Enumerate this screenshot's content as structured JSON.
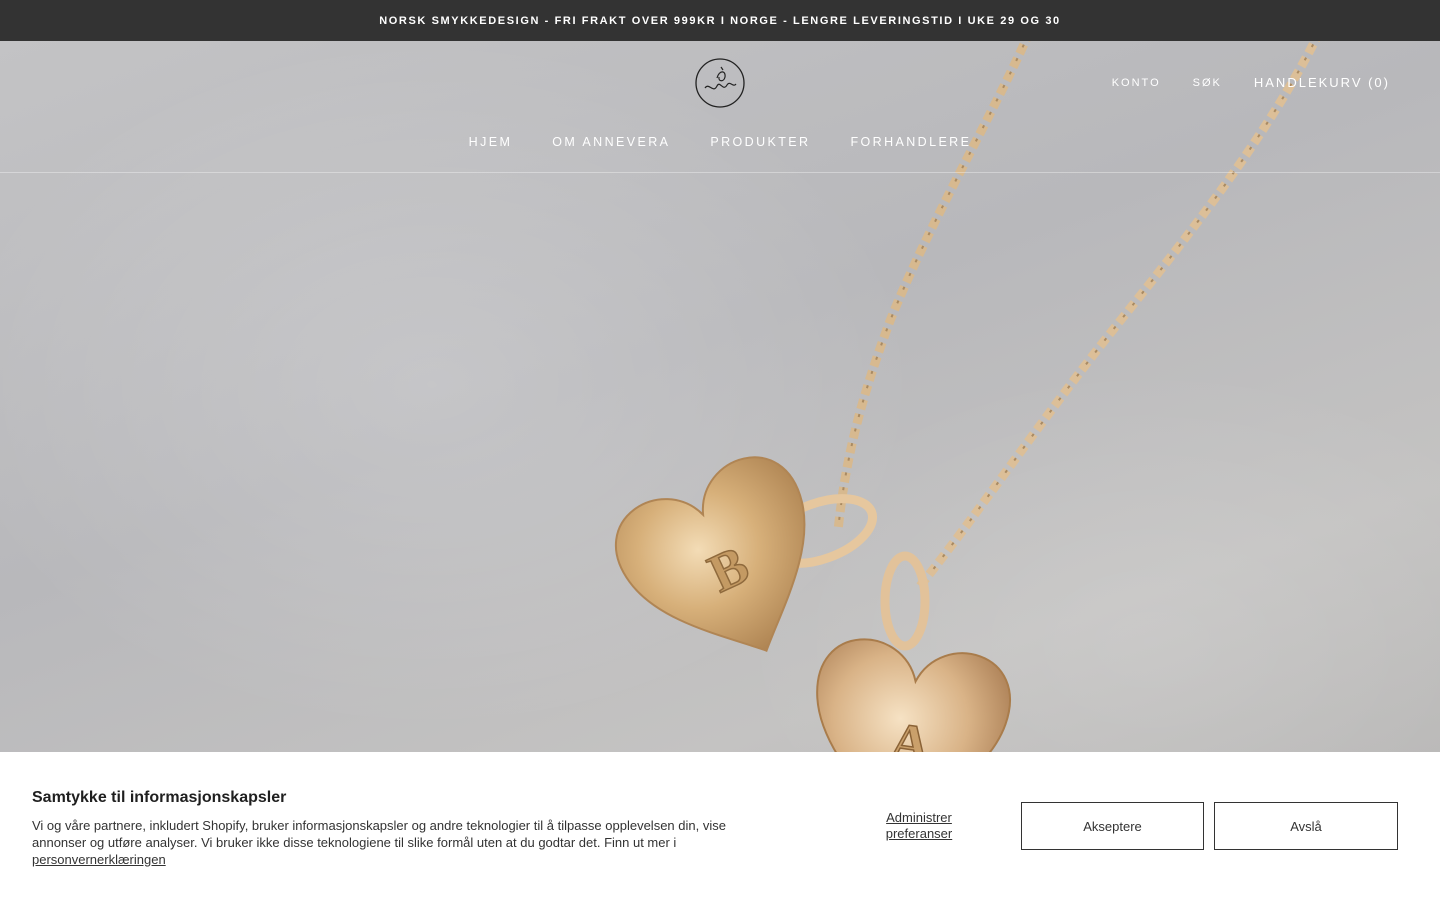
{
  "announcement": {
    "text": "NORSK SMYKKEDESIGN - FRI FRAKT OVER 999KR I NORGE - LENGRE LEVERINGSTID I UKE 29 OG 30"
  },
  "header": {
    "links": {
      "account": "KONTO",
      "search": "SØK",
      "cart": "HANDLEKURV (0)"
    },
    "nav": [
      {
        "label": "HJEM"
      },
      {
        "label": "OM ANNEVERA"
      },
      {
        "label": "PRODUKTER"
      },
      {
        "label": "FORHANDLERE"
      }
    ]
  },
  "hero": {
    "pendants": [
      "B",
      "A"
    ]
  },
  "cookie_banner": {
    "title": "Samtykke til informasjonskapsler",
    "body": "Vi og våre partnere, inkludert Shopify, bruker informasjonskapsler og andre teknologier til å tilpasse opplevelsen din, vise annonser og utføre analyser. Vi bruker ikke disse teknologiene til slike formål uten at du godtar det. Finn ut mer i",
    "privacy_link": "personvernerklæringen",
    "manage_label_line1": "Administrer",
    "manage_label_line2": "preferanser",
    "accept_label": "Akseptere",
    "decline_label": "Avslå"
  },
  "colors": {
    "announcement_bg": "#333333",
    "gold": "#c9a46a",
    "banner_bg": "#ffffff"
  }
}
